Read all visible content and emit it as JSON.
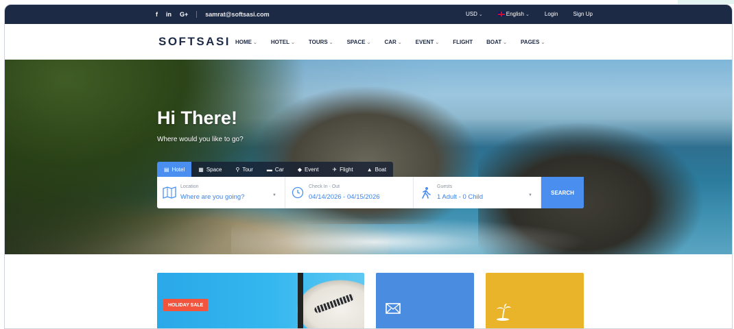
{
  "topbar": {
    "social": [
      "f",
      "in",
      "G+"
    ],
    "email": "samrat@softsasi.com",
    "currency": "USD",
    "language": "English",
    "login": "Login",
    "signup": "Sign Up"
  },
  "nav": {
    "logo": "SOFTSASI",
    "items": [
      {
        "label": "HOME",
        "has_dropdown": true
      },
      {
        "label": "HOTEL",
        "has_dropdown": true
      },
      {
        "label": "TOURS",
        "has_dropdown": true
      },
      {
        "label": "SPACE",
        "has_dropdown": true
      },
      {
        "label": "CAR",
        "has_dropdown": true
      },
      {
        "label": "EVENT",
        "has_dropdown": true
      },
      {
        "label": "FLIGHT",
        "has_dropdown": false
      },
      {
        "label": "BOAT",
        "has_dropdown": true
      },
      {
        "label": "PAGES",
        "has_dropdown": true
      }
    ]
  },
  "hero": {
    "title": "Hi There!",
    "subtitle": "Where would you like to go?"
  },
  "search": {
    "tabs": [
      {
        "label": "Hotel",
        "icon": "hotel-icon",
        "active": true
      },
      {
        "label": "Space",
        "icon": "space-icon",
        "active": false
      },
      {
        "label": "Tour",
        "icon": "tour-icon",
        "active": false
      },
      {
        "label": "Car",
        "icon": "car-icon",
        "active": false
      },
      {
        "label": "Event",
        "icon": "event-icon",
        "active": false
      },
      {
        "label": "Flight",
        "icon": "flight-icon",
        "active": false
      },
      {
        "label": "Boat",
        "icon": "boat-icon",
        "active": false
      }
    ],
    "location": {
      "label": "Location",
      "value": "Where are you going?"
    },
    "dates": {
      "label": "Check In - Out",
      "value": "04/14/2026 - 04/15/2026"
    },
    "guests": {
      "label": "Guests",
      "value": "1 Adult - 0 Child"
    },
    "button": "SEARCH"
  },
  "cards": {
    "badge": "HOLIDAY SALE"
  },
  "colors": {
    "topbar": "#1d2a45",
    "accent": "#4a8ff0",
    "sale": "#f2543d",
    "card_blue": "#4a8ce0",
    "card_yellow": "#e9b42a"
  }
}
